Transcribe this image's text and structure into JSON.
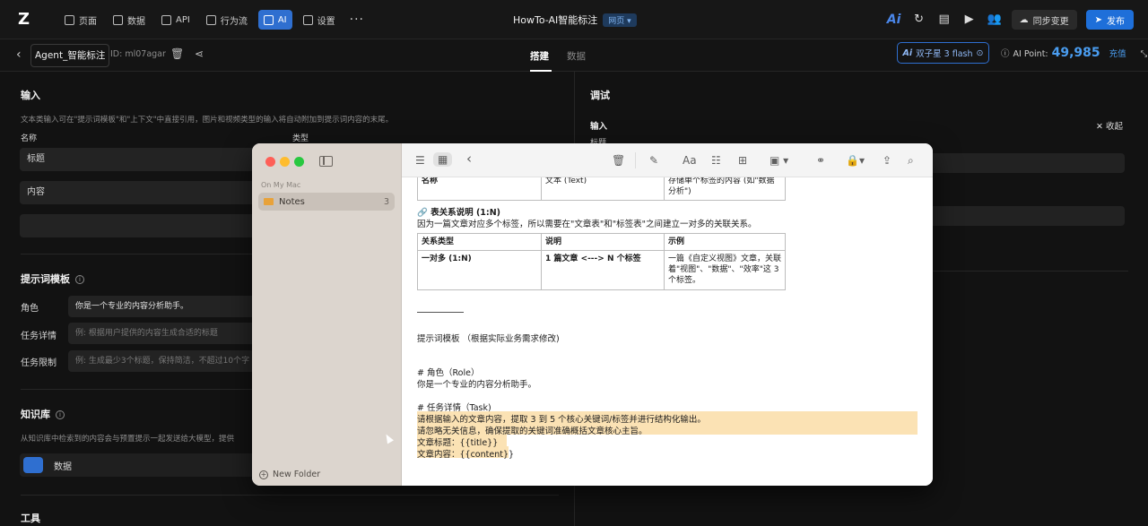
{
  "topbar": {
    "nav": [
      {
        "label": "页面",
        "icon": "page-icon"
      },
      {
        "label": "数据",
        "icon": "database-icon"
      },
      {
        "label": "API",
        "icon": "api-icon"
      },
      {
        "label": "行为流",
        "icon": "flow-icon"
      },
      {
        "label": "AI",
        "icon": "ai-icon",
        "active": true
      },
      {
        "label": "设置",
        "icon": "gear-icon"
      }
    ],
    "more": "···",
    "app_title": "HowTo-AI智能标注",
    "web_badge": "网页 ▾",
    "sync_label": "同步变更",
    "publish_label": "发布"
  },
  "subbar": {
    "agent_name": "Agent_智能标注",
    "agent_id": "ID: ml07agar",
    "tabs": [
      "搭建",
      "数据"
    ],
    "model": "双子星 3 flash",
    "ai_point_label": "AI Point:",
    "ai_point_value": "49,985",
    "recharge": "充值"
  },
  "left": {
    "input_title": "输入",
    "input_desc": "文本类输入可在\"提示词模板\"和\"上下文\"中直接引用，图片和视频类型的输入将自动附加到提示词内容的末尾。",
    "col_name": "名称",
    "col_type": "类型",
    "fields": [
      "标题",
      "内容",
      ""
    ],
    "prompt_title": "提示词模板",
    "prompt_rows": [
      {
        "label": "角色",
        "value": "你是一个专业的内容分析助手。",
        "filled": true
      },
      {
        "label": "任务详情",
        "value": "例: 根据用户提供的内容生成合适的标题",
        "filled": false
      },
      {
        "label": "任务限制",
        "value": "例: 生成最少3个标题，保持简洁，不超过10个字",
        "filled": false
      }
    ],
    "kb_title": "知识库",
    "kb_desc": "从知识库中检索到的内容会与预置提示一起发送给大模型，提供",
    "kb_item": "数据",
    "tools_title": "工具"
  },
  "right": {
    "title": "调试",
    "input_label": "输入",
    "collapse": "收起",
    "field_label": "标题"
  },
  "notes": {
    "section": "On My Mac",
    "folder": "Notes",
    "folder_count": "3",
    "new_folder": "New Folder",
    "top_row": [
      "名称",
      "文本 (Text)",
      "存储单个标签的内容 (如\"数据分析\")"
    ],
    "relation_title": "🔗 表关系说明 (1:N)",
    "relation_desc": "因为一篇文章对应多个标签，所以需要在\"文章表\"和\"标签表\"之间建立一对多的关联关系。",
    "rel_headers": [
      "关系类型",
      "说明",
      "示例"
    ],
    "rel_row": [
      "一对多 (1:N)",
      "1 篇文章 <---> N 个标签",
      "一篇《自定义视图》文章，关联着\"视图\"、\"数据\"、\"效率\"这 3 个标签。"
    ],
    "template_title": "提示词模板 （根据实际业务需求修改)",
    "role_head": "# 角色（Role）",
    "role_text": "你是一个专业的内容分析助手。",
    "task_head": "# 任务详情（Task)",
    "task_lines": [
      "请根据输入的文章内容，提取 3 到 5 个核心关键词/标签并进行结构化输出。",
      "请忽略无关信息，确保提取的关键词准确概括文章核心主旨。",
      "文章标题：{{title}}",
      "文章内容：{{content}}"
    ]
  }
}
